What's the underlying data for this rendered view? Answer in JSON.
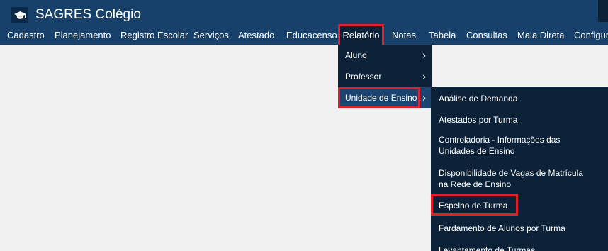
{
  "app": {
    "title": "SAGRES Colégio",
    "logo_icon": "graduation-cap-icon"
  },
  "nav": {
    "items": [
      "Cadastro",
      "Planejamento",
      "Registro Escolar",
      "Serviços",
      "Atestado",
      "Educacenso",
      "Relatório",
      "Notas",
      "Tabela",
      "Consultas",
      "Mala Direta",
      "Configura"
    ],
    "active": "Relatório"
  },
  "relatorio_menu": {
    "items": [
      {
        "label": "Aluno",
        "chevron": "›"
      },
      {
        "label": "Professor",
        "chevron": "›"
      },
      {
        "label": "Unidade de Ensino",
        "chevron": "›"
      }
    ],
    "selected": "Unidade de Ensino"
  },
  "unidade_submenu": {
    "items": [
      "Análise de Demanda",
      "Atestados por Turma",
      "Controladoria - Informações das Unidades de Ensino",
      "Disponibilidade de Vagas de Matrícula na Rede de Ensino",
      "Espelho de Turma",
      "Fardamento de Alunos por Turma",
      "Levantamento de Turmas"
    ],
    "highlighted": "Espelho de Turma"
  },
  "colors": {
    "header": "#17406a",
    "menu_background": "#0c2239",
    "highlight_border": "#e2202b",
    "page_background": "#f0f0f0"
  }
}
